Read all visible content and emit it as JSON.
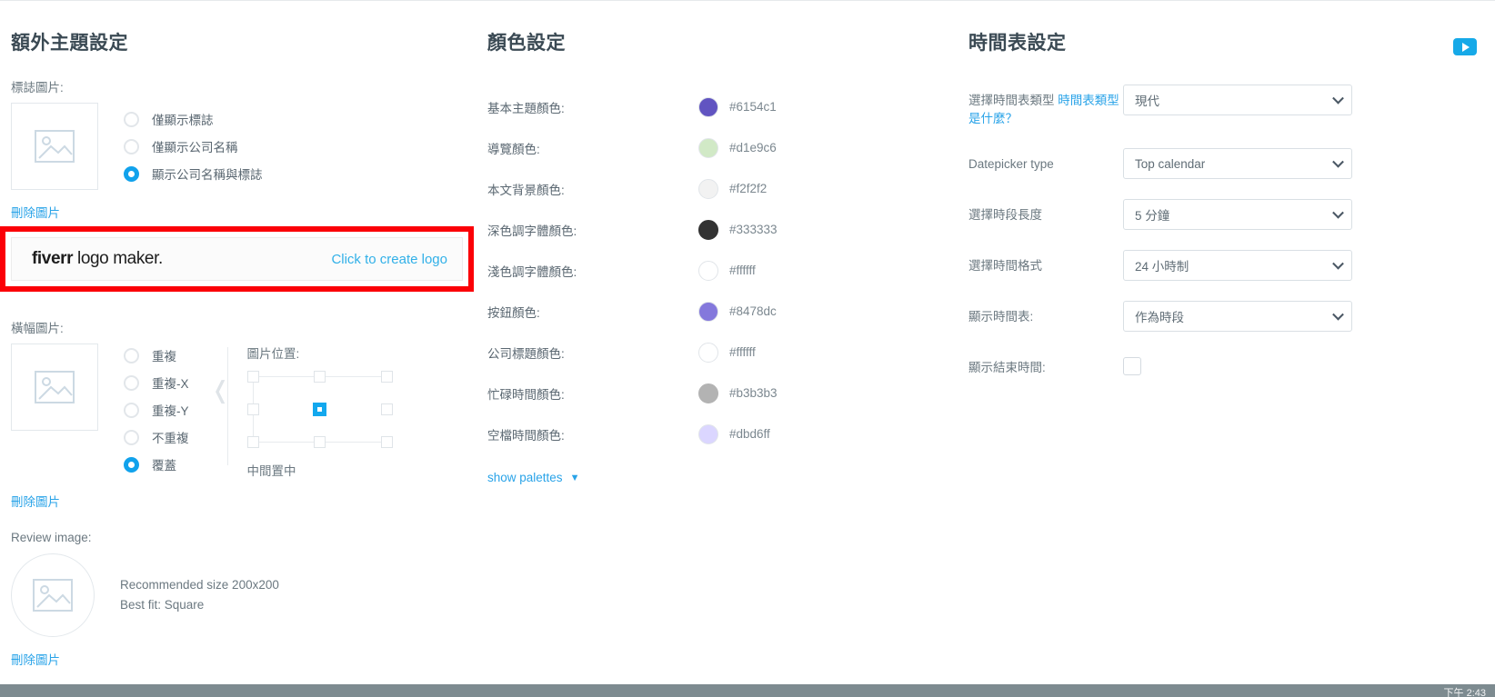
{
  "theme": {
    "title": "額外主題設定",
    "logo_label": "標誌圖片:",
    "logo_options": [
      {
        "label": "僅顯示標誌",
        "checked": false
      },
      {
        "label": "僅顯示公司名稱",
        "checked": false
      },
      {
        "label": "顯示公司名稱與標誌",
        "checked": true
      }
    ],
    "logo_delete": "刪除圖片",
    "banner_label": "橫幅圖片:",
    "banner_options": [
      {
        "label": "重複",
        "checked": false
      },
      {
        "label": "重複-X",
        "checked": false
      },
      {
        "label": "重複-Y",
        "checked": false
      },
      {
        "label": "不重複",
        "checked": false
      },
      {
        "label": "覆蓋",
        "checked": true
      }
    ],
    "banner_delete": "刪除圖片",
    "position_label": "圖片位置:",
    "position_value": "中間置中",
    "review_label": "Review image:",
    "review_hint_line1": "Recommended size 200x200",
    "review_hint_line2": "Best fit: Square",
    "review_delete": "刪除圖片"
  },
  "fiverr": {
    "logo_bold": "fiverr",
    "logo_rest": " logo maker.",
    "cta": "Click to create logo",
    "highlight_color": "#fb0007"
  },
  "colors": {
    "title": "顏色設定",
    "rows": [
      {
        "label": "基本主題顏色:",
        "hex": "#6154c1",
        "swatch": "#6154c1"
      },
      {
        "label": "導覽顏色:",
        "hex": "#d1e9c6",
        "swatch": "#d1e9c6"
      },
      {
        "label": "本文背景顏色:",
        "hex": "#f2f2f2",
        "swatch": "#f2f2f2"
      },
      {
        "label": "深色調字體顏色:",
        "hex": "#333333",
        "swatch": "#333333"
      },
      {
        "label": "淺色調字體顏色:",
        "hex": "#ffffff",
        "swatch": "#ffffff"
      },
      {
        "label": "按鈕顏色:",
        "hex": "#8478dc",
        "swatch": "#8478dc"
      },
      {
        "label": "公司標題顏色:",
        "hex": "#ffffff",
        "swatch": "#ffffff"
      },
      {
        "label": "忙碌時間顏色:",
        "hex": "#b3b3b3",
        "swatch": "#b3b3b3"
      },
      {
        "label": "空檔時間顏色:",
        "hex": "#dbd6ff",
        "swatch": "#dbd6ff"
      }
    ],
    "show_palettes": "show palettes"
  },
  "schedule": {
    "title": "時間表設定",
    "rows": [
      {
        "label": "選擇時間表類型 ",
        "label_link": "時間表類型是什麼？",
        "value": "現代",
        "type": "select"
      },
      {
        "label": "Datepicker type",
        "label_link": "",
        "value": "Top calendar",
        "type": "select"
      },
      {
        "label": "選擇時段長度",
        "label_link": "",
        "value": "5 分鐘",
        "type": "select"
      },
      {
        "label": "選擇時間格式",
        "label_link": "",
        "value": "24 小時制",
        "type": "select"
      },
      {
        "label": "顯示時間表:",
        "label_link": "",
        "value": "作為時段",
        "type": "select"
      },
      {
        "label": "顯示結束時間:",
        "label_link": "",
        "value": "",
        "type": "checkbox"
      }
    ]
  },
  "footer": {
    "text": "下午 2:43"
  },
  "icons": {
    "video": "play-icon"
  }
}
